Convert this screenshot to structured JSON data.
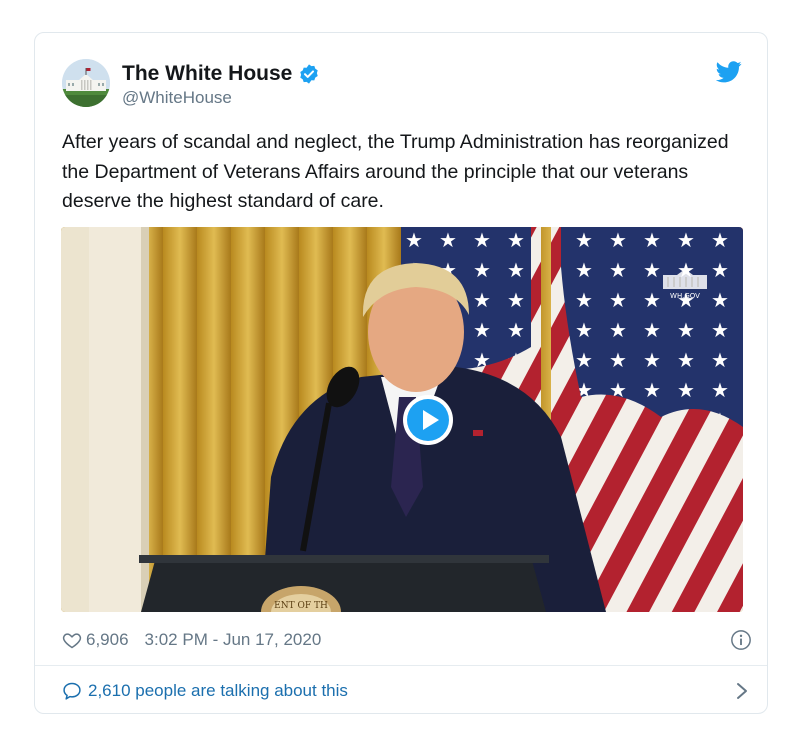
{
  "tweet": {
    "display_name": "The White House",
    "handle": "@WhiteHouse",
    "text": "After years of scandal and neglect, the Trump Administration has reorganized the Department of Veterans Affairs around the principle that our veterans deserve the highest standard of care.",
    "likes": "6,906",
    "timestamp": "3:02 PM - Jun 17, 2020",
    "talking_text": "2,610 people are talking about this",
    "media": {
      "watermark_text": "WH.GOV",
      "seal_text": "ENT OF TH"
    }
  },
  "icons": {
    "verified": "verified-badge-icon",
    "twitter": "twitter-bird-icon",
    "like": "heart-icon",
    "info": "info-icon",
    "talk": "speech-bubble-icon",
    "chevron": "chevron-right-icon",
    "play": "play-icon"
  },
  "colors": {
    "twitter_blue": "#1da1f2",
    "link_blue": "#1b6fae",
    "text": "#14171a",
    "secondary": "#657786",
    "border": "#e1e8ed"
  }
}
